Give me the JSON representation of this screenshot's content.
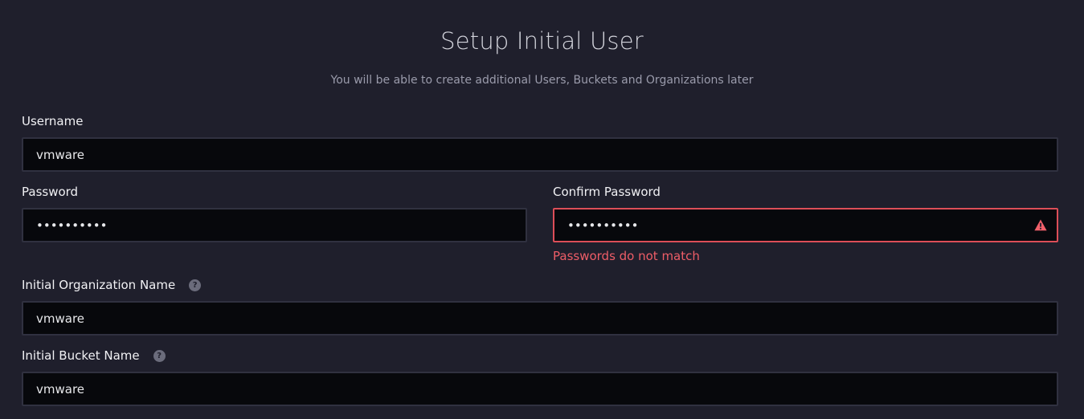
{
  "header": {
    "title": "Setup Initial User",
    "subtitle": "You will be able to create additional Users, Buckets and Organizations later"
  },
  "form": {
    "username": {
      "label": "Username",
      "value": "vmware"
    },
    "password": {
      "label": "Password",
      "value": "••••••••••"
    },
    "confirm_password": {
      "label": "Confirm Password",
      "value": "••••••••••",
      "error": "Passwords do not match",
      "status_icon": "warning-icon",
      "error_color": "#dc4e58"
    },
    "org_name": {
      "label": "Initial Organization Name",
      "value": "vmware",
      "help_icon": "question-icon",
      "help_glyph": "?"
    },
    "bucket_name": {
      "label": "Initial Bucket Name",
      "value": "vmware",
      "help_icon": "question-icon",
      "help_glyph": "?"
    }
  }
}
